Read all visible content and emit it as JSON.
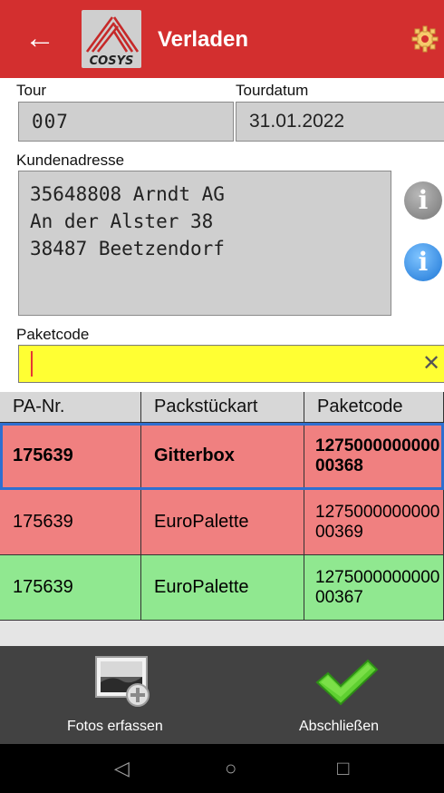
{
  "appbar": {
    "back_icon": "arrow-left-icon",
    "logo_text": "COSYS",
    "title": "Verladen",
    "settings_icon": "gear-icon",
    "color": "#d32f2f"
  },
  "tour": {
    "label": "Tour",
    "value": "007"
  },
  "tourdatum": {
    "label": "Tourdatum",
    "value": "31.01.2022"
  },
  "kundenadresse": {
    "label": "Kundenadresse",
    "lines": [
      "35648808 Arndt AG",
      "An der Alster 38",
      "38487 Beetzendorf"
    ]
  },
  "info_buttons": [
    "info-icon",
    "info-icon"
  ],
  "paketcode": {
    "label": "Paketcode",
    "value": "",
    "clear_icon": "close-icon",
    "background": "#ffff33"
  },
  "table": {
    "headers": [
      "PA-Nr.",
      "Packstückart",
      "Paketcode"
    ],
    "rows": [
      {
        "pa_nr": "175639",
        "art": "Gitterbox",
        "code": "127500000000000368",
        "color": "#f08080",
        "selected": true
      },
      {
        "pa_nr": "175639",
        "art": "EuroPalette",
        "code": "127500000000000369",
        "color": "#f08080",
        "selected": false
      },
      {
        "pa_nr": "175639",
        "art": "EuroPalette",
        "code": "127500000000000367",
        "color": "#90e890",
        "selected": false
      }
    ]
  },
  "bottom": {
    "fotos_label": "Fotos erfassen",
    "fotos_icon": "photo-add-icon",
    "abschliessen_label": "Abschließen",
    "abschliessen_icon": "checkmark-icon"
  },
  "navbar": {
    "back": "nav-back-icon",
    "home": "nav-home-icon",
    "recents": "nav-recents-icon"
  }
}
